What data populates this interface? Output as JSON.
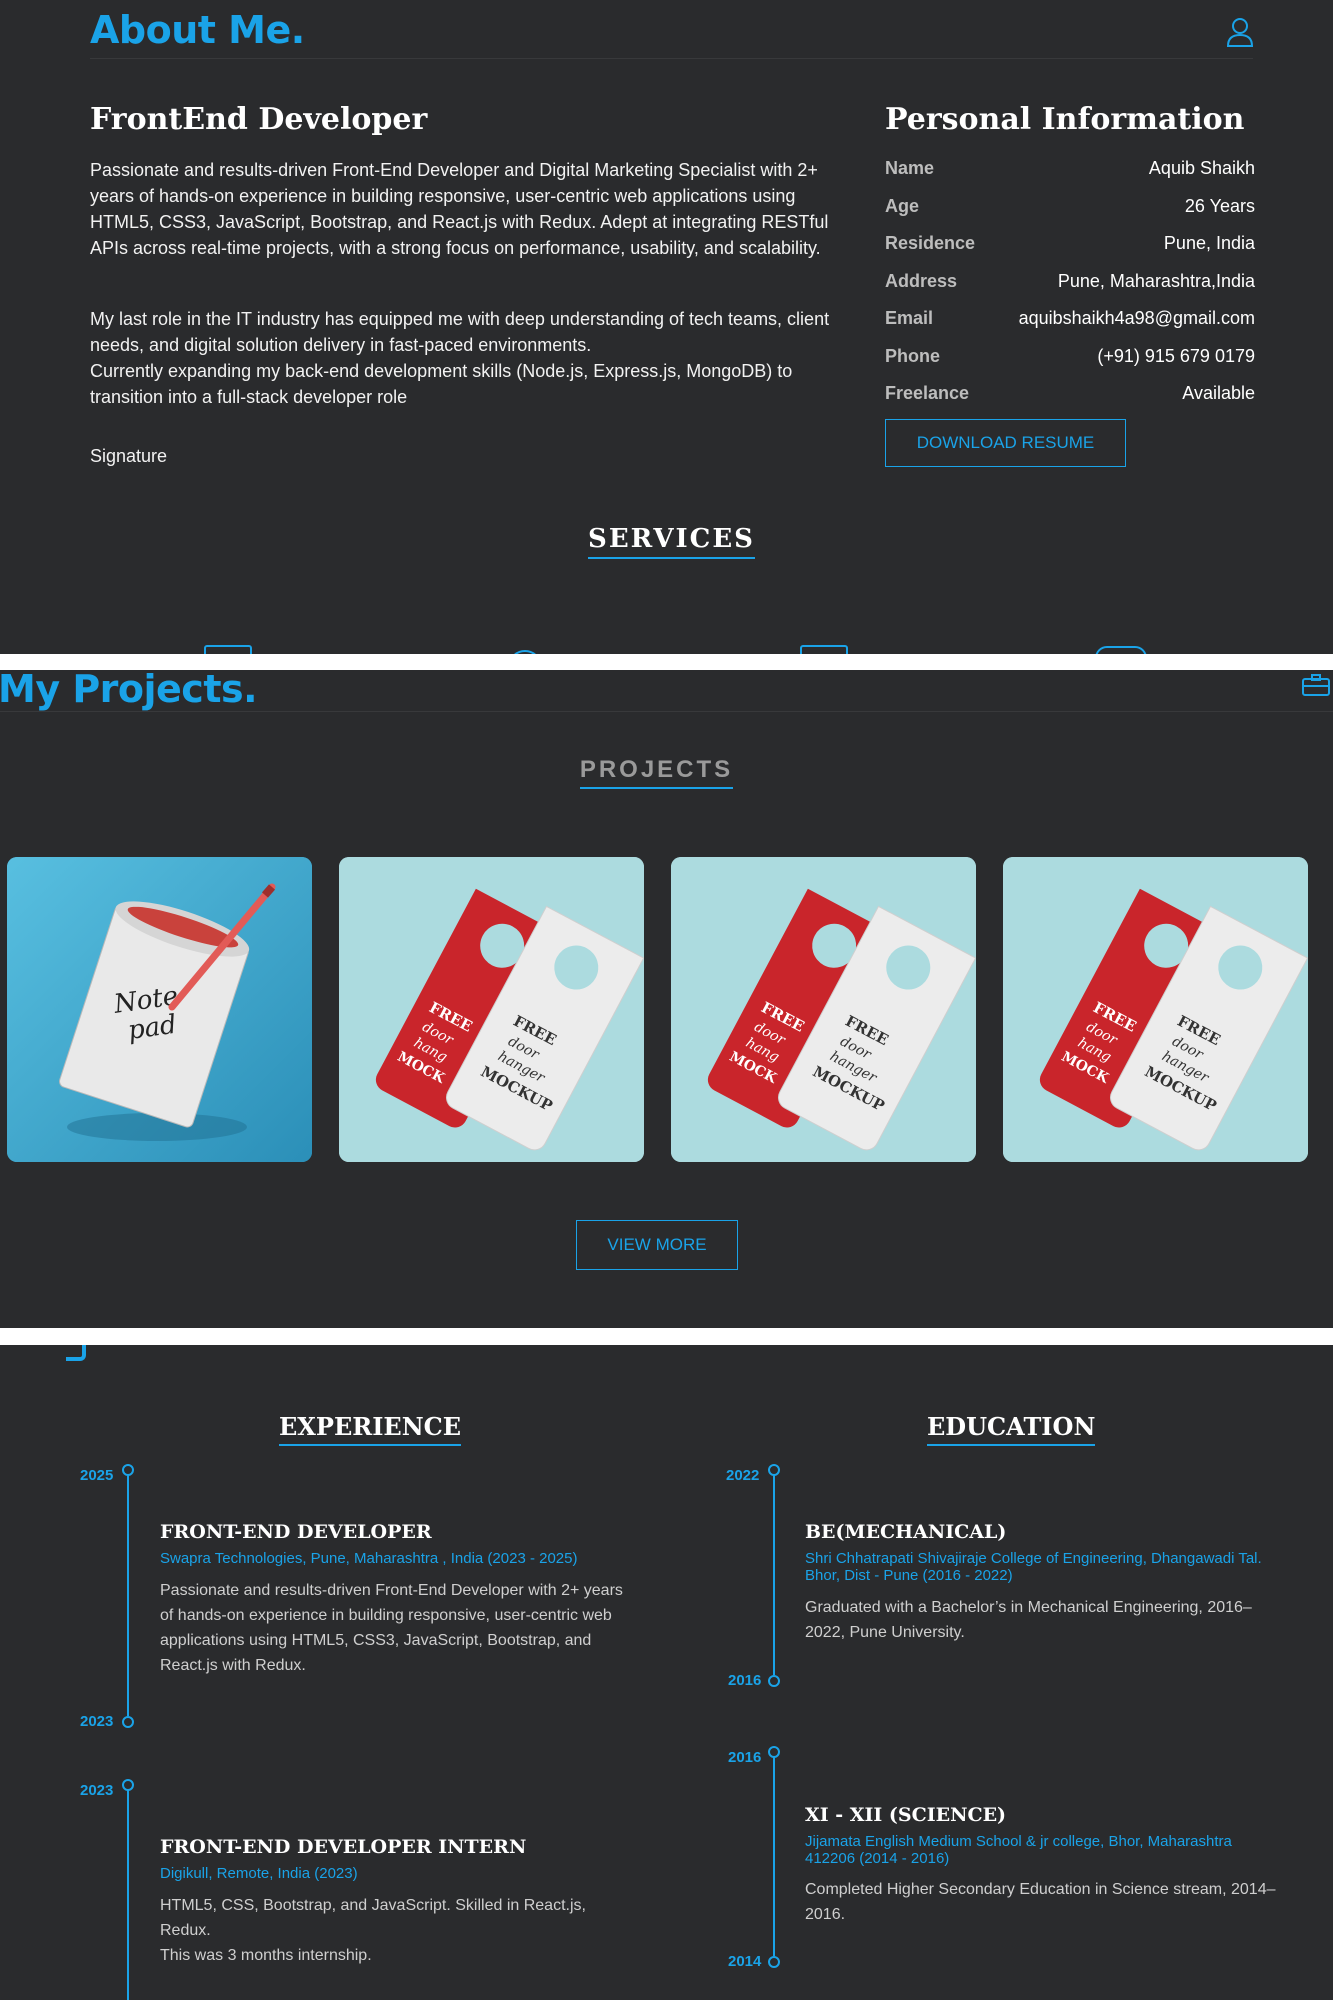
{
  "about": {
    "header": "About Me.",
    "role": "FrontEnd Developer",
    "para1": "Passionate and results-driven Front-End Developer and Digital Marketing Specialist with 2+ years of hands-on experience in building responsive, user-centric web applications using HTML5, CSS3, JavaScript, Bootstrap, and React.js with Redux. Adept at integrating RESTful APIs across real-time projects, with a strong focus on performance, usability, and scalability.",
    "para2": "My last role in the IT industry has equipped me with deep understanding of tech teams, client needs, and digital solution delivery in fast-paced environments.",
    "para3": "Currently expanding my back-end development skills (Node.js, Express.js, MongoDB) to transition into a full-stack developer role",
    "signature_alt": "Signature",
    "info_title": "Personal Information",
    "info": [
      {
        "label": "Name",
        "value": "Aquib Shaikh"
      },
      {
        "label": "Age",
        "value": "26 Years"
      },
      {
        "label": "Residence",
        "value": "Pune, India"
      },
      {
        "label": "Address",
        "value": "Pune, Maharashtra,India"
      },
      {
        "label": "Email",
        "value": "aquibshaikh4a98@gmail.com"
      },
      {
        "label": "Phone",
        "value": "(+91) 915 679 0179"
      },
      {
        "label": "Freelance",
        "value": "Available"
      }
    ],
    "download_label": "DOWNLOAD RESUME",
    "services_title": "SERVICES",
    "icon": "user-icon"
  },
  "projects": {
    "header": "My Projects.",
    "title": "PROJECTS",
    "view_more": "VIEW MORE",
    "icon": "briefcase-icon",
    "cards": [
      {
        "name": "notepad-mockup",
        "text": "Note pad"
      },
      {
        "name": "door-hanger-mockup",
        "text": "FREE door hanger MOCKUP"
      },
      {
        "name": "door-hanger-mockup",
        "text": "FREE door hanger MOCKUP"
      },
      {
        "name": "door-hanger-mockup",
        "text": "FREE door hanger MOCKUP"
      }
    ]
  },
  "resume": {
    "experience_title": "EXPERIENCE",
    "education_title": "EDUCATION",
    "experience": [
      {
        "start": "2025",
        "end": "2023",
        "title": "FRONT-END DEVELOPER",
        "org": "Swapra Technologies, Pune, Maharashtra , India (2023 - 2025)",
        "desc": "Passionate and results-driven Front-End Developer with 2+ years of hands-on experience in building responsive, user-centric web applications using HTML5, CSS3, JavaScript, Bootstrap, and React.js with Redux."
      },
      {
        "start": "2023",
        "end": "",
        "title": "FRONT-END DEVELOPER INTERN",
        "org": "Digikull, Remote, India (2023)",
        "desc": "HTML5, CSS, Bootstrap, and JavaScript. Skilled in React.js, Redux.",
        "desc2": "This was 3 months internship."
      }
    ],
    "education": [
      {
        "start": "2022",
        "end": "2016",
        "title": "BE(MECHANICAL)",
        "org": "Shri Chhatrapati Shivajiraje College of Engineering, Dhangawadi Tal. Bhor, Dist - Pune (2016 - 2022)",
        "desc": "Graduated with a Bachelor’s in Mechanical Engineering, 2016–2022, Pune University."
      },
      {
        "start": "2016",
        "end": "2014",
        "title": "XI - XII (SCIENCE)",
        "org": "Jijamata English Medium School & jr college, Bhor, Maharashtra 412206 (2014 - 2016)",
        "desc": "Completed Higher Secondary Education in Science stream, 2014–2016."
      }
    ]
  },
  "colors": {
    "accent": "#1aa3e8",
    "panel": "#2a2b2d"
  }
}
